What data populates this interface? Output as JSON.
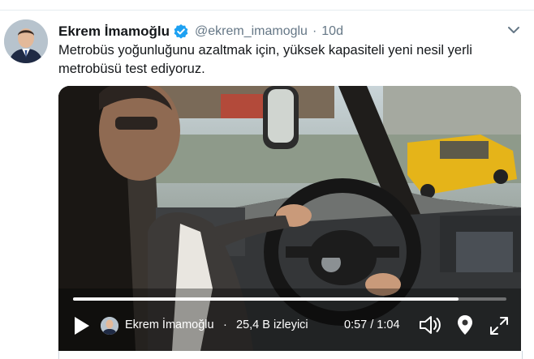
{
  "tweet": {
    "author_name": "Ekrem İmamoğlu",
    "handle": "@ekrem_imamoglu",
    "separator": "·",
    "time_ago": "10d",
    "text": "Metrobüs yoğunluğunu azaltmak için, yüksek kapasiteli yeni nesil yerli metrobüsü test ediyoruz.",
    "avatar_icon": "person-avatar",
    "verified_icon": "verified-badge-icon",
    "more_icon": "chevron-down-icon"
  },
  "video": {
    "uploader_name": "Ekrem İmamoğlu",
    "separator": "·",
    "views": "25,4 B izleyici",
    "time_display": "0:57 / 1:04",
    "progress_fraction": 0.89,
    "icons": [
      "play-icon",
      "volume-icon",
      "location-icon",
      "fullscreen-icon"
    ]
  },
  "colors": {
    "verified": "#1da1f2",
    "meta_text": "#657786",
    "name_text": "#14171a"
  }
}
